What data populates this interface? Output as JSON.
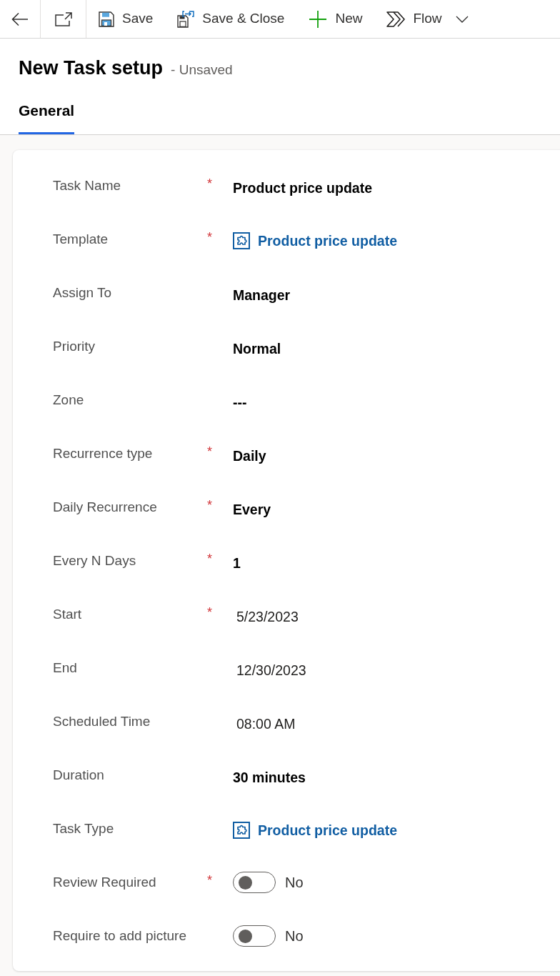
{
  "toolbar": {
    "commands": [
      {
        "label": "Save"
      },
      {
        "label": "Save & Close"
      },
      {
        "label": "New"
      },
      {
        "label": "Flow"
      }
    ]
  },
  "header": {
    "title": "New Task setup",
    "status": "- Unsaved"
  },
  "tabs": [
    {
      "label": "General",
      "selected": true
    }
  ],
  "fields": [
    {
      "label": "Task Name",
      "required_mark": "*",
      "kind": "text",
      "value": "Product price update"
    },
    {
      "label": "Template",
      "required_mark": "*",
      "kind": "lookup",
      "value": "Product price update"
    },
    {
      "label": "Assign To",
      "kind": "text",
      "value": "Manager"
    },
    {
      "label": "Priority",
      "kind": "text",
      "value": "Normal"
    },
    {
      "label": "Zone",
      "kind": "text",
      "value": "---"
    },
    {
      "label": "Recurrence type",
      "required_mark": "*",
      "kind": "text",
      "value": "Daily"
    },
    {
      "label": "Daily Recurrence",
      "required_mark": "*",
      "kind": "text",
      "value": "Every"
    },
    {
      "label": "Every N Days",
      "required_mark": "*",
      "kind": "text",
      "value": "1"
    },
    {
      "label": "Start",
      "required_mark": "*",
      "kind": "date",
      "value": "5/23/2023"
    },
    {
      "label": "End",
      "kind": "date",
      "value": "12/30/2023"
    },
    {
      "label": "Scheduled Time",
      "kind": "time",
      "value": "08:00 AM"
    },
    {
      "label": "Duration",
      "kind": "text",
      "value": "30 minutes"
    },
    {
      "label": "Task Type",
      "kind": "lookup",
      "value": "Product price update"
    },
    {
      "label": "Review Required",
      "required_mark": "*",
      "kind": "toggle",
      "on": false,
      "value": "No"
    },
    {
      "label": "Require to add picture",
      "kind": "toggle",
      "on": false,
      "value": "No"
    }
  ]
}
